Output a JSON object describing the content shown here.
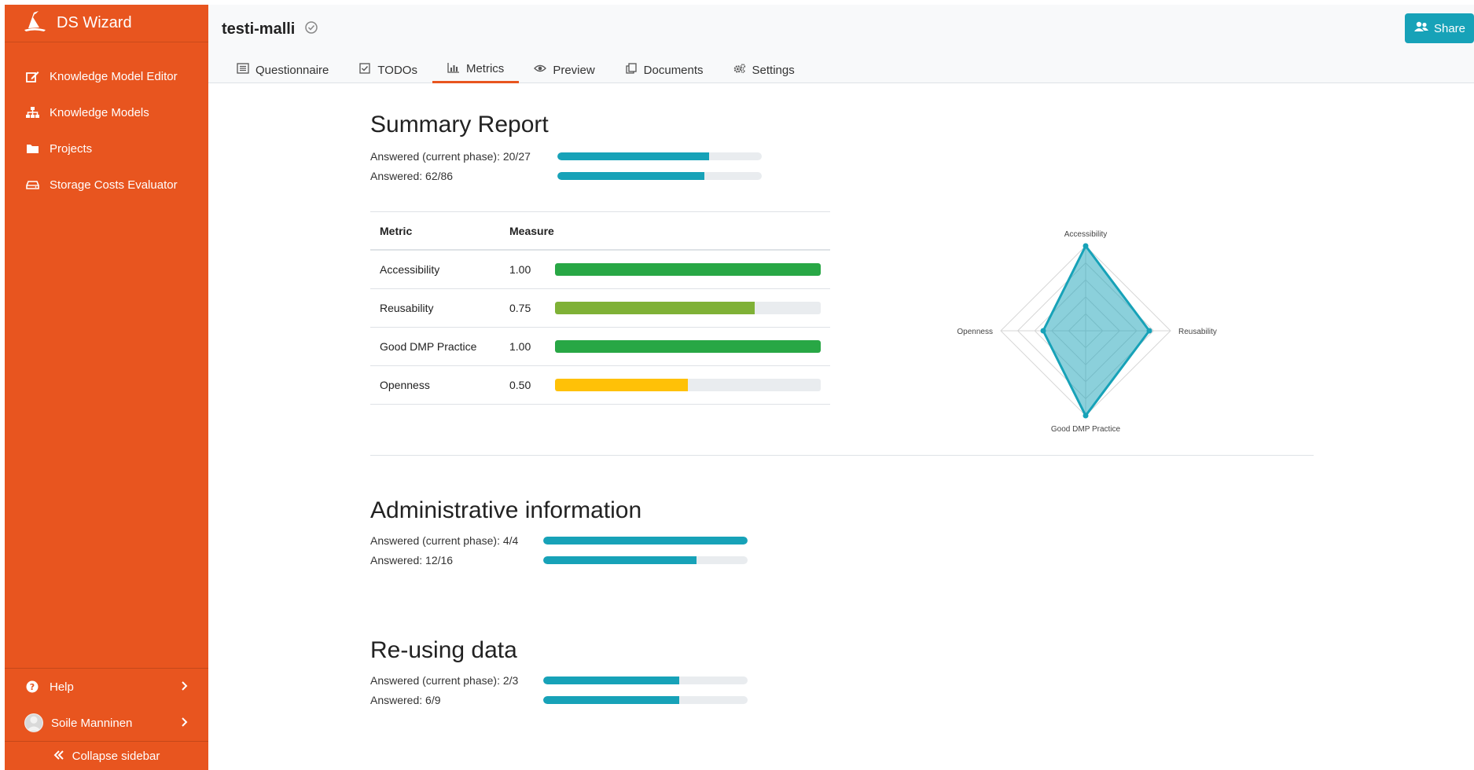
{
  "app": {
    "name": "DS Wizard"
  },
  "sidebar": {
    "items": [
      {
        "label": "Knowledge Model Editor",
        "icon": "edit-icon"
      },
      {
        "label": "Knowledge Models",
        "icon": "sitemap-icon"
      },
      {
        "label": "Projects",
        "icon": "folder-icon"
      },
      {
        "label": "Storage Costs Evaluator",
        "icon": "hdd-icon"
      }
    ],
    "help_label": "Help",
    "user_name": "Soile Manninen",
    "collapse_label": "Collapse sidebar"
  },
  "header": {
    "project_title": "testi-malli",
    "share_label": "Share",
    "tabs": [
      {
        "label": "Questionnaire",
        "icon": "list-icon"
      },
      {
        "label": "TODOs",
        "icon": "checkbox-icon"
      },
      {
        "label": "Metrics",
        "icon": "bar-chart-icon",
        "active": true
      },
      {
        "label": "Preview",
        "icon": "eye-icon"
      },
      {
        "label": "Documents",
        "icon": "copy-icon"
      },
      {
        "label": "Settings",
        "icon": "cogs-icon"
      }
    ]
  },
  "summary": {
    "title": "Summary Report",
    "progress": [
      {
        "label": "Answered (current phase): 20/27",
        "answered": 20,
        "total": 27
      },
      {
        "label": "Answered: 62/86",
        "answered": 62,
        "total": 86
      }
    ],
    "table": {
      "headers": [
        "Metric",
        "Measure"
      ],
      "rows": [
        {
          "metric": "Accessibility",
          "value": "1.00",
          "fraction": 1.0,
          "color": "#28a745"
        },
        {
          "metric": "Reusability",
          "value": "0.75",
          "fraction": 0.75,
          "color": "#7fb136"
        },
        {
          "metric": "Good DMP Practice",
          "value": "1.00",
          "fraction": 1.0,
          "color": "#28a745"
        },
        {
          "metric": "Openness",
          "value": "0.50",
          "fraction": 0.5,
          "color": "#ffc107"
        }
      ]
    }
  },
  "chart_data": {
    "type": "radar",
    "axes": [
      "Accessibility",
      "Reusability",
      "Good DMP Practice",
      "Openness"
    ],
    "values": [
      1.0,
      0.75,
      1.0,
      0.5
    ],
    "range": [
      0,
      1
    ],
    "color": "#17a2b8"
  },
  "sections": [
    {
      "title": "Administrative information",
      "progress": [
        {
          "label": "Answered (current phase): 4/4",
          "answered": 4,
          "total": 4
        },
        {
          "label": "Answered: 12/16",
          "answered": 12,
          "total": 16
        }
      ]
    },
    {
      "title": "Re-using data",
      "progress": [
        {
          "label": "Answered (current phase): 2/3",
          "answered": 2,
          "total": 3
        },
        {
          "label": "Answered: 6/9",
          "answered": 6,
          "total": 9
        }
      ]
    }
  ]
}
